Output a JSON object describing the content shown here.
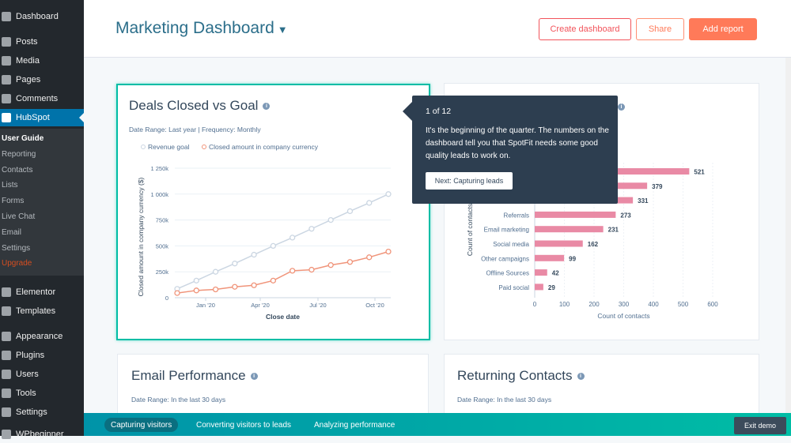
{
  "sidebar": {
    "items": [
      {
        "label": "Dashboard",
        "icon": "dashboard-icon"
      },
      {
        "label": "Posts",
        "icon": "pin-icon"
      },
      {
        "label": "Media",
        "icon": "media-icon"
      },
      {
        "label": "Pages",
        "icon": "pages-icon"
      },
      {
        "label": "Comments",
        "icon": "comment-icon"
      },
      {
        "label": "HubSpot",
        "icon": "hubspot-icon",
        "active": true
      },
      {
        "label": "Elementor",
        "icon": "elementor-icon"
      },
      {
        "label": "Templates",
        "icon": "folder-icon"
      },
      {
        "label": "Appearance",
        "icon": "brush-icon"
      },
      {
        "label": "Plugins",
        "icon": "plugin-icon"
      },
      {
        "label": "Users",
        "icon": "user-icon"
      },
      {
        "label": "Tools",
        "icon": "wrench-icon"
      },
      {
        "label": "Settings",
        "icon": "settings-icon"
      },
      {
        "label": "WPbeginner",
        "icon": "generic-icon"
      }
    ],
    "submenu": [
      "User Guide",
      "Reporting",
      "Contacts",
      "Lists",
      "Forms",
      "Live Chat",
      "Email",
      "Settings",
      "Upgrade"
    ]
  },
  "header": {
    "title": "Marketing Dashboard",
    "create_label": "Create dashboard",
    "share_label": "Share",
    "add_label": "Add report"
  },
  "cards": {
    "deals": {
      "title": "Deals Closed vs Goal",
      "meta": "Date Range: Last year | Frequency: Monthly"
    },
    "email": {
      "title": "Email Performance",
      "meta": "Date Range: In the last 30 days"
    },
    "returning": {
      "title": "Returning Contacts",
      "meta": "Date Range: In the last 30 days"
    }
  },
  "tooltip": {
    "count": "1 of 12",
    "body": "It's the beginning of the quarter. The numbers on the dashboard tell you that SpotFit needs some good quality leads to work on.",
    "next_label": "Next: Capturing leads"
  },
  "bottom_bar": {
    "steps": [
      "Capturing visitors",
      "Converting visitors to leads",
      "Analyzing performance"
    ],
    "exit_label": "Exit demo"
  },
  "colors": {
    "accent": "#00bda5",
    "primary_button": "#ff7a59",
    "goal": "#cbd6e2",
    "closed": "#f0947a",
    "bar": "#e98aa5"
  },
  "chart_data": [
    {
      "type": "line",
      "xlabel": "Close date",
      "ylabel": "Closed amount in company currency ($)",
      "x_tick_labels": [
        "Jan '20",
        "Apr '20",
        "Jul '20",
        "Oct '20"
      ],
      "y_tick_labels": [
        "0",
        "250k",
        "500k",
        "750k",
        "1 000k",
        "1 250k"
      ],
      "ylim": [
        0,
        1250000
      ],
      "grid": true,
      "legend_placement": "top-left",
      "series": [
        {
          "name": "Revenue goal",
          "values": [
            85000,
            165000,
            250000,
            330000,
            415000,
            500000,
            580000,
            665000,
            750000,
            835000,
            915000,
            1000000
          ]
        },
        {
          "name": "Closed amount in company currency",
          "values": [
            45000,
            70000,
            80000,
            105000,
            120000,
            165000,
            260000,
            270000,
            315000,
            345000,
            390000,
            445000
          ]
        }
      ]
    },
    {
      "type": "bar",
      "orientation": "horizontal",
      "xlabel": "Count of contacts",
      "ylabel": "Count of contacts",
      "categories": [
        "",
        "",
        "Direct traffic",
        "Referrals",
        "Email marketing",
        "Social media",
        "Other campaigns",
        "Offline Sources",
        "Paid social"
      ],
      "values": [
        521,
        379,
        331,
        273,
        231,
        162,
        99,
        42,
        29
      ],
      "x_tick_labels": [
        "0",
        "100",
        "200",
        "300",
        "400",
        "500",
        "600"
      ],
      "xlim": [
        0,
        600
      ],
      "grid": true
    }
  ]
}
